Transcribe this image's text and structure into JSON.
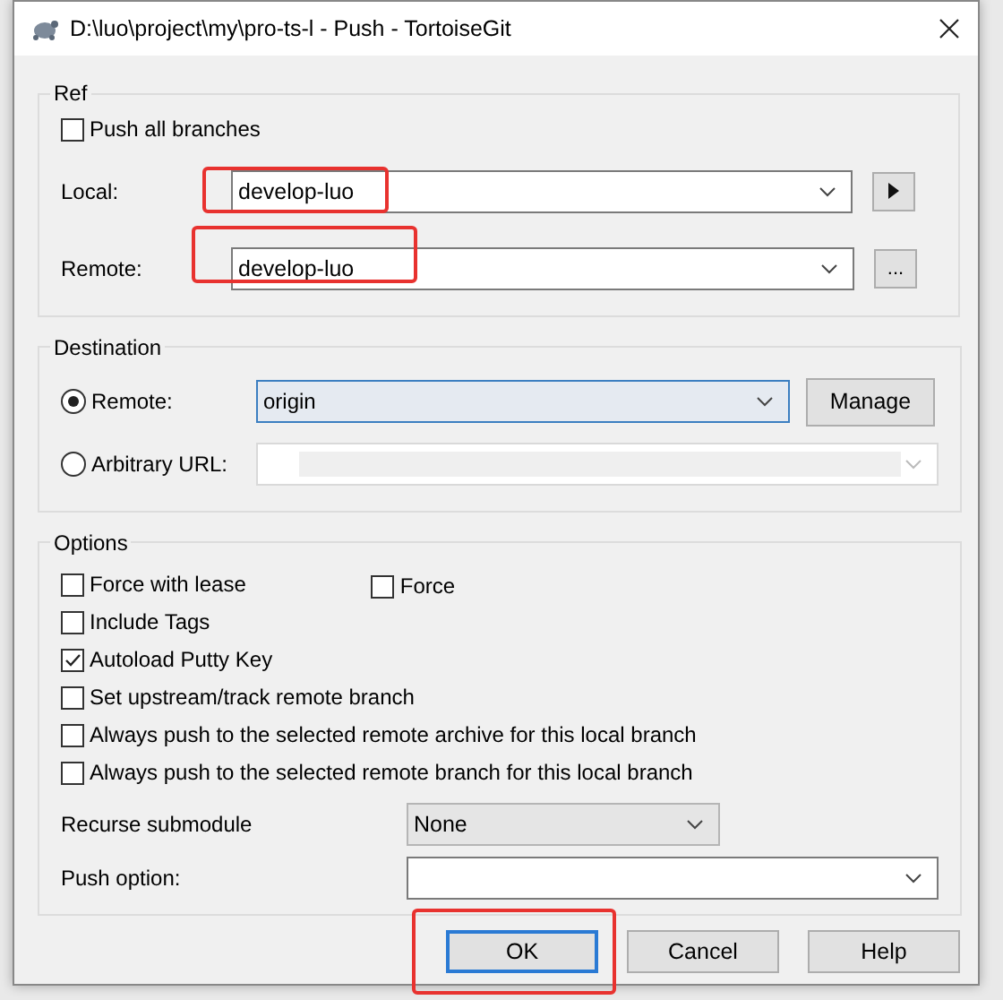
{
  "window": {
    "title": "D:\\luo\\project\\my\\pro-ts-l - Push - TortoiseGit"
  },
  "ref": {
    "title": "Ref",
    "push_all": {
      "label": "Push all branches",
      "checked": false
    },
    "fields": [
      {
        "label": "Local:",
        "value": "develop-luo",
        "highlighted": true,
        "kind": "arrow"
      },
      {
        "label": "Remote:",
        "value": "develop-luo",
        "highlighted": true,
        "kind": "browse",
        "button": "..."
      }
    ]
  },
  "destination": {
    "title": "Destination",
    "manage": "Manage",
    "options": [
      {
        "label": "Remote:",
        "selected": true,
        "value": "origin",
        "kind": "combo"
      },
      {
        "label": "Arbitrary URL:",
        "selected": false,
        "kind": "url"
      }
    ]
  },
  "options": {
    "title": "Options",
    "rows": [
      [
        {
          "label": "Force with lease",
          "checked": false
        },
        {
          "label": "Force",
          "checked": false
        }
      ],
      [
        {
          "label": "Include Tags",
          "checked": false
        }
      ],
      [
        {
          "label": "Autoload Putty Key",
          "checked": true
        }
      ],
      [
        {
          "label": "Set upstream/track remote branch",
          "checked": false
        }
      ],
      [
        {
          "label": "Always push to the selected remote archive for this local branch",
          "checked": false
        }
      ],
      [
        {
          "label": "Always push to the selected remote branch for this local branch",
          "checked": false
        }
      ]
    ],
    "recurse": {
      "label": "Recurse submodule",
      "value": "None"
    },
    "push_option": {
      "label": "Push option:"
    }
  },
  "buttons": [
    {
      "label": "OK",
      "default": true,
      "highlighted": true
    },
    {
      "label": "Cancel",
      "default": false,
      "highlighted": false
    },
    {
      "label": "Help",
      "default": false,
      "highlighted": false
    }
  ]
}
